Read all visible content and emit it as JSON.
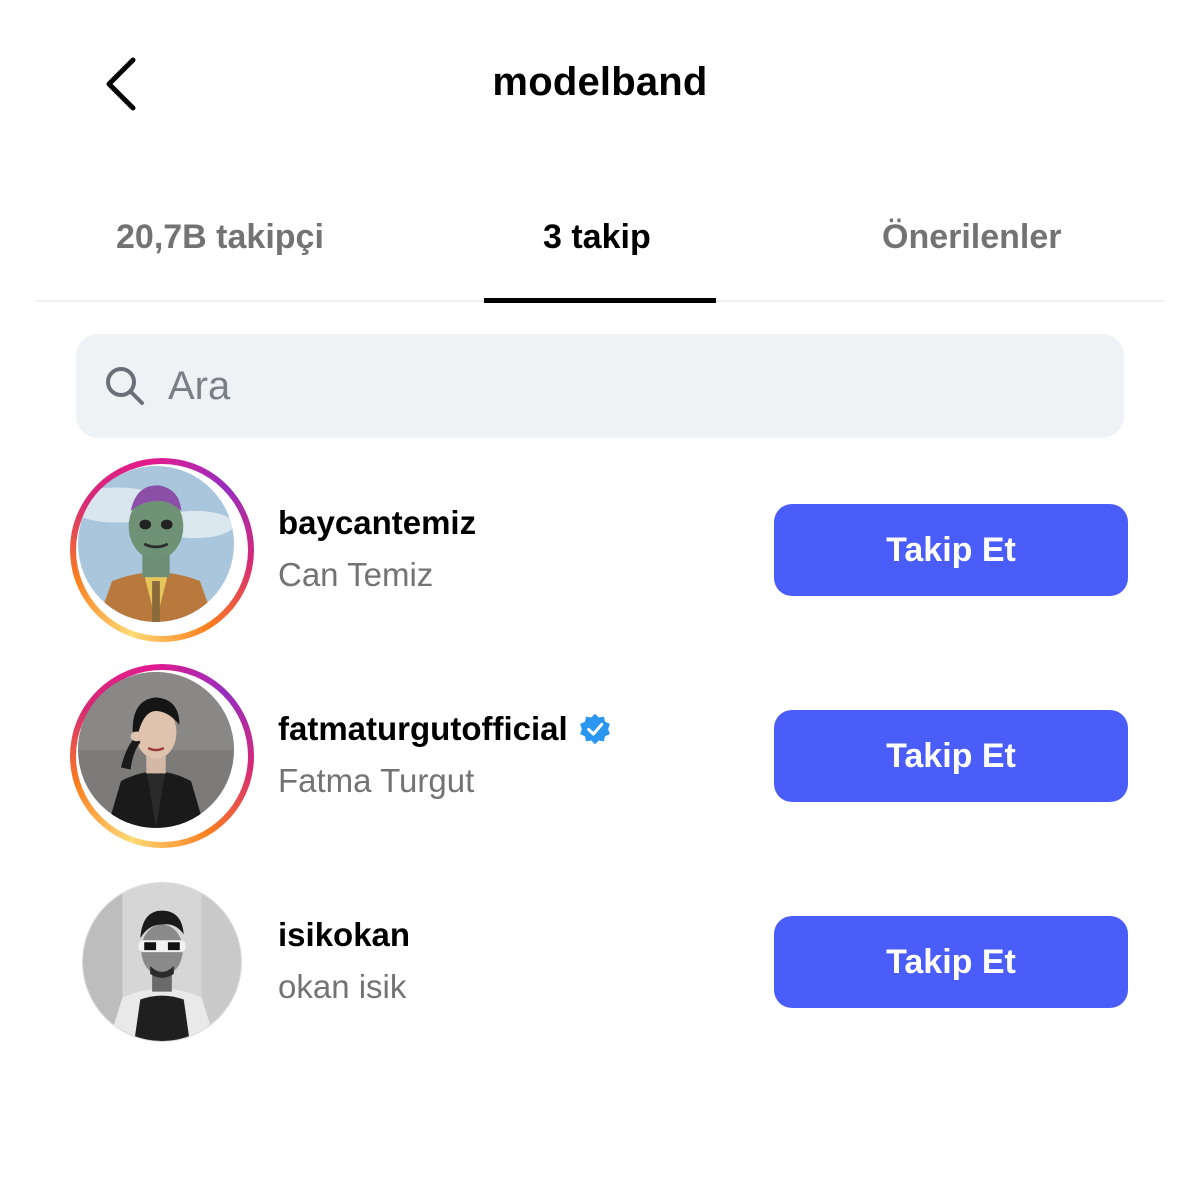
{
  "header": {
    "title": "modelband",
    "back_icon": "chevron-left-icon"
  },
  "tabs": [
    {
      "label": "20,7B takipçi",
      "active": false
    },
    {
      "label": "3 takip",
      "active": true
    },
    {
      "label": "Önerilenler",
      "active": false
    }
  ],
  "search": {
    "placeholder": "Ara",
    "icon": "search-icon"
  },
  "colors": {
    "follow_button": "#4a5df9",
    "verified_badge": "#2a96f0",
    "story_ring": [
      "#feda75",
      "#fa7e1e",
      "#d62976",
      "#962fbf"
    ]
  },
  "following": [
    {
      "username": "baycantemiz",
      "full_name": "Can Temiz",
      "verified": false,
      "story_ring": true,
      "button": "Takip Et"
    },
    {
      "username": "fatmaturgutofficial",
      "full_name": "Fatma Turgut",
      "verified": true,
      "story_ring": true,
      "button": "Takip Et"
    },
    {
      "username": "isikokan",
      "full_name": "okan isik",
      "verified": false,
      "story_ring": false,
      "button": "Takip Et"
    }
  ]
}
